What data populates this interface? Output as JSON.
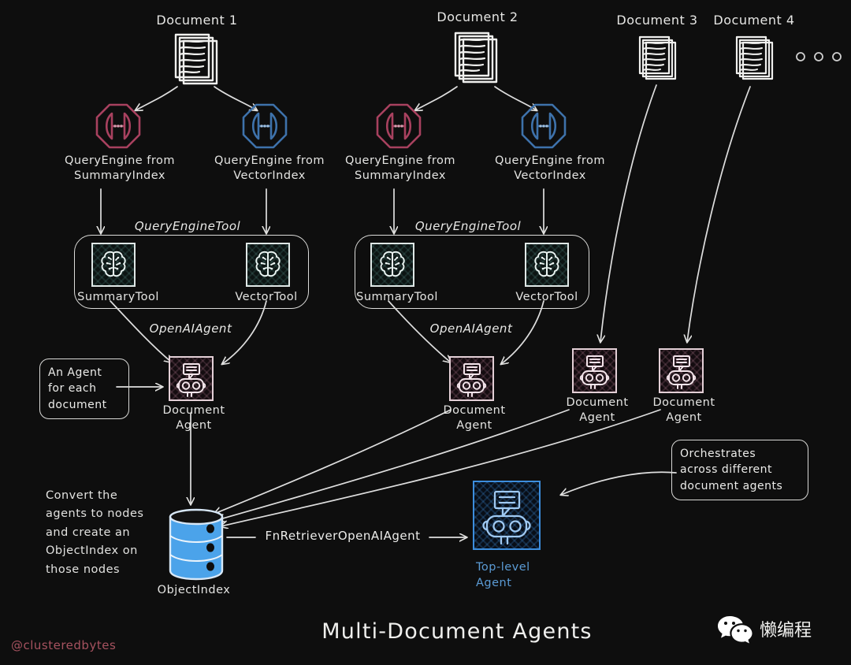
{
  "diagram": {
    "title": "Multi-Document Agents",
    "watermark": "@clusteredbytes",
    "background_color": "#0e0e0e",
    "ink_color": "#e8e8e6"
  },
  "documents": [
    {
      "label": "Document 1"
    },
    {
      "label": "Document 2"
    },
    {
      "label": "Document 3"
    },
    {
      "label": "Document 4"
    }
  ],
  "ellipsis": "o  o  o",
  "query_engines": [
    {
      "label": "QueryEngine from\nSummaryIndex",
      "color": "#a8415f",
      "kind": "summary"
    },
    {
      "label": "QueryEngine from\nVectorIndex",
      "color": "#3e72ab",
      "kind": "vector"
    },
    {
      "label": "QueryEngine from\nSummaryIndex",
      "color": "#a8415f",
      "kind": "summary"
    },
    {
      "label": "QueryEngine from\nVectorIndex",
      "color": "#3e72ab",
      "kind": "vector"
    }
  ],
  "edge_labels": {
    "query_engine_tool_1": "QueryEngineTool",
    "query_engine_tool_2": "QueryEngineTool",
    "openai_agent_1": "OpenAIAgent",
    "openai_agent_2": "OpenAIAgent",
    "fn_retriever": "FnRetrieverOpenAIAgent"
  },
  "tool_groups": [
    {
      "tools": [
        {
          "label": "SummaryTool"
        },
        {
          "label": "VectorTool"
        }
      ]
    },
    {
      "tools": [
        {
          "label": "SummaryTool"
        },
        {
          "label": "VectorTool"
        }
      ]
    }
  ],
  "document_agents": [
    {
      "label": "Document\nAgent"
    },
    {
      "label": "Document\nAgent"
    },
    {
      "label": "Document\nAgent"
    },
    {
      "label": "Document\nAgent"
    }
  ],
  "callouts": {
    "agent_per_document": "An Agent\nfor each\ndocument",
    "orchestrates": "Orchestrates\nacross different\ndocument agents"
  },
  "notes": {
    "object_index_note": "Convert the\nagents to nodes\nand create an\nObjectIndex on\nthose nodes"
  },
  "object_index": {
    "label": "ObjectIndex",
    "color": "#4ba3ea"
  },
  "top_level_agent": {
    "label": "Top-level\nAgent",
    "color": "#3c8ddd"
  },
  "branding": {
    "wechat_name": "懒编程"
  }
}
